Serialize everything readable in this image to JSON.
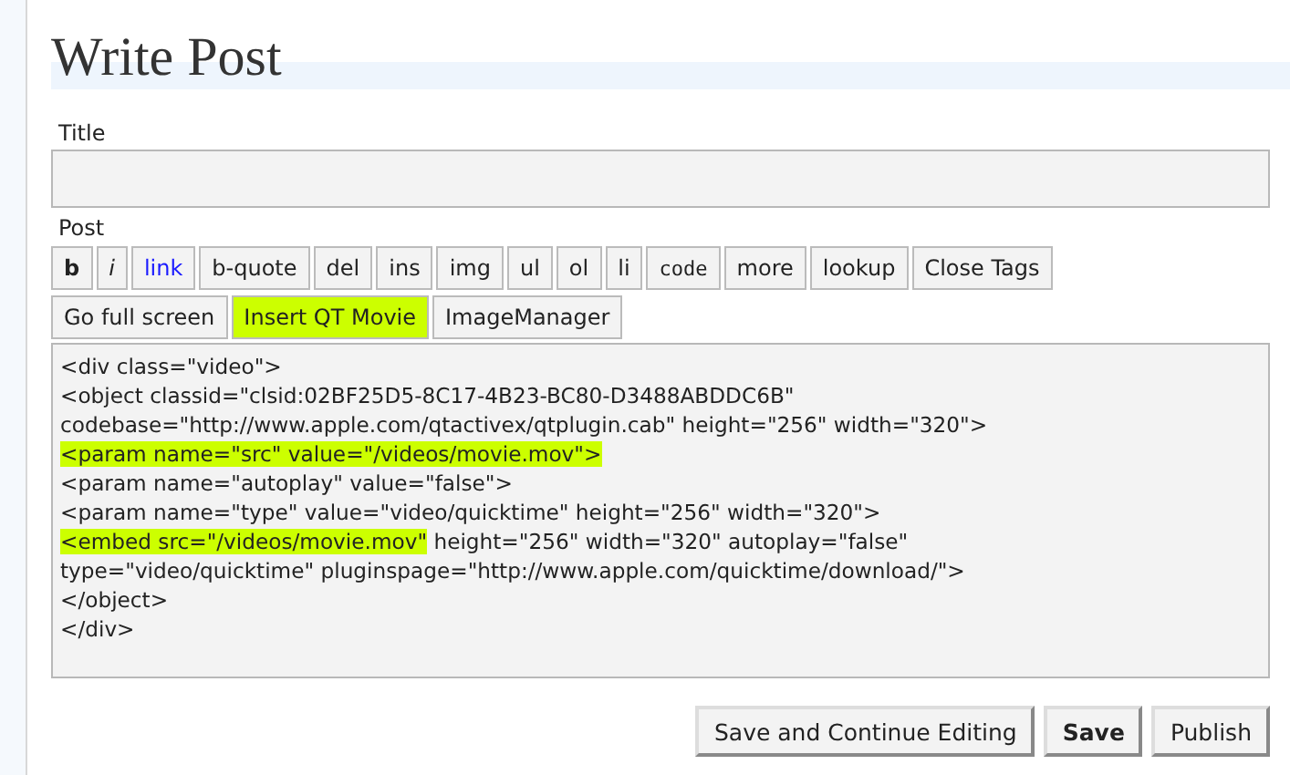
{
  "heading": "Write Post",
  "title_field": {
    "label": "Title"
  },
  "post_label": "Post",
  "toolbar_rows": [
    [
      {
        "label": "b",
        "kind": "bold",
        "highlighted": false
      },
      {
        "label": "i",
        "kind": "italic",
        "highlighted": false
      },
      {
        "label": "link",
        "kind": "link",
        "highlighted": false
      },
      {
        "label": "b-quote",
        "kind": "plain",
        "highlighted": false
      },
      {
        "label": "del",
        "kind": "plain",
        "highlighted": false
      },
      {
        "label": "ins",
        "kind": "plain",
        "highlighted": false
      },
      {
        "label": "img",
        "kind": "plain",
        "highlighted": false
      },
      {
        "label": "ul",
        "kind": "plain",
        "highlighted": false
      },
      {
        "label": "ol",
        "kind": "plain",
        "highlighted": false
      },
      {
        "label": "li",
        "kind": "plain",
        "highlighted": false
      },
      {
        "label": "code",
        "kind": "mono",
        "highlighted": false
      },
      {
        "label": "more",
        "kind": "plain",
        "highlighted": false
      },
      {
        "label": "lookup",
        "kind": "plain",
        "highlighted": false
      },
      {
        "label": "Close Tags",
        "kind": "plain",
        "highlighted": false
      }
    ],
    [
      {
        "label": "Go full screen",
        "kind": "plain",
        "highlighted": false
      },
      {
        "label": "Insert QT Movie",
        "kind": "plain",
        "highlighted": true
      },
      {
        "label": "ImageManager",
        "kind": "plain",
        "highlighted": false
      }
    ]
  ],
  "code_lines": [
    [
      {
        "text": "<div class=\"video\">",
        "highlighted": false
      }
    ],
    [
      {
        "text": "<object classid=\"clsid:02BF25D5-8C17-4B23-BC80-D3488ABDDC6B\"",
        "highlighted": false
      }
    ],
    [
      {
        "text": "codebase=\"http://www.apple.com/qtactivex/qtplugin.cab\" height=\"256\" width=\"320\">",
        "highlighted": false
      }
    ],
    [
      {
        "text": "<param name=\"src\" value=\"/videos/movie.mov\">",
        "highlighted": true
      }
    ],
    [
      {
        "text": "<param name=\"autoplay\" value=\"false\">",
        "highlighted": false
      }
    ],
    [
      {
        "text": "<param name=\"type\" value=\"video/quicktime\" height=\"256\" width=\"320\">",
        "highlighted": false
      }
    ],
    [
      {
        "text": "<embed src=\"/videos/movie.mov\"",
        "highlighted": true
      },
      {
        "text": " height=\"256\" width=\"320\" autoplay=\"false\"",
        "highlighted": false
      }
    ],
    [
      {
        "text": "type=\"video/quicktime\" pluginspage=\"http://www.apple.com/quicktime/download/\">",
        "highlighted": false
      }
    ],
    [
      {
        "text": "</object>",
        "highlighted": false
      }
    ],
    [
      {
        "text": "</div>",
        "highlighted": false
      }
    ]
  ],
  "actions": [
    {
      "label": "Save and Continue Editing",
      "primary": false
    },
    {
      "label": "Save",
      "primary": true
    },
    {
      "label": "Publish",
      "primary": false
    }
  ]
}
